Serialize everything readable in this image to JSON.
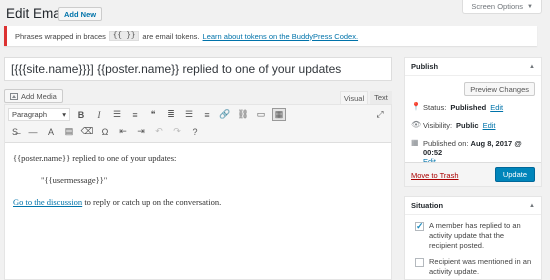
{
  "header": {
    "screen_options": "Screen Options",
    "title": "Edit Email",
    "add_new": "Add New"
  },
  "notice": {
    "prefix": "Phrases wrapped in braces",
    "token": "{{ }}",
    "middle": "are email tokens.",
    "link": "Learn about tokens on the BuddyPress Codex."
  },
  "post_title": "[{{{site.name}}}] {{poster.name}} replied to one of your updates",
  "editor": {
    "add_media": "Add Media",
    "tab_visual": "Visual",
    "tab_text": "Text",
    "format_select": "Paragraph",
    "content": {
      "line1": "{{poster.name}} replied to one of your updates:",
      "line2": "\"{{usermessage}}\"",
      "link": "Go to the discussion",
      "line3_rest": " to reply or catch up on the conversation."
    }
  },
  "publish": {
    "heading": "Publish",
    "preview": "Preview Changes",
    "status_label": "Status:",
    "status_value": "Published",
    "visibility_label": "Visibility:",
    "visibility_value": "Public",
    "date_label": "Published on:",
    "date_value": "Aug 8, 2017 @ 00:52",
    "edit": "Edit",
    "trash": "Move to Trash",
    "update": "Update"
  },
  "situation": {
    "heading": "Situation",
    "items": [
      {
        "label": "A member has replied to an activity update that the recipient posted.",
        "checked": true
      },
      {
        "label": "Recipient was mentioned in an activity update.",
        "checked": false
      }
    ]
  },
  "colors": {
    "accent": "#0073aa",
    "update_button": "#0085ba",
    "notice_border": "#dc3232",
    "trash": "#a00000"
  }
}
